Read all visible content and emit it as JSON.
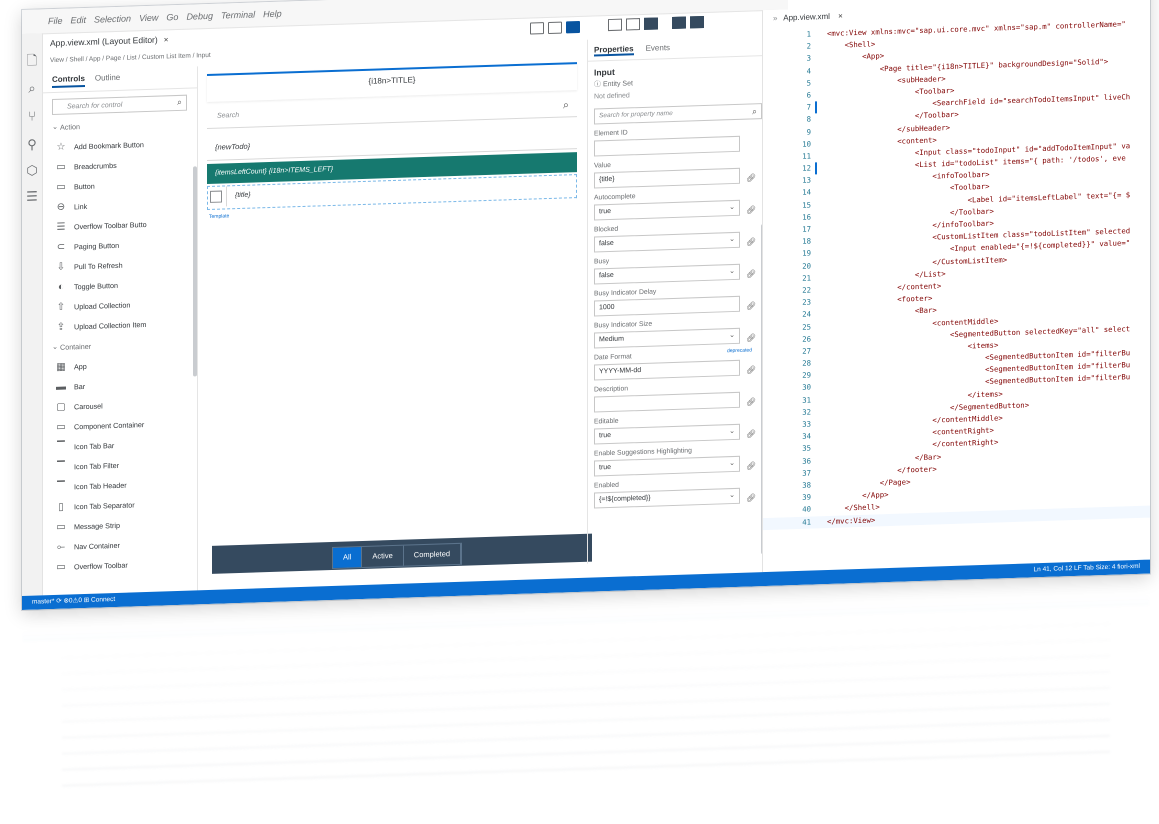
{
  "menu": [
    "File",
    "Edit",
    "Selection",
    "View",
    "Go",
    "Debug",
    "Terminal",
    "Help"
  ],
  "editor_tab": {
    "label": "App.view.xml (Layout Editor)",
    "close": "×"
  },
  "breadcrumb": "View / Shell / App / Page / List / Custom List Item / Input",
  "controls_tabs": [
    "Controls",
    "Outline"
  ],
  "controls_search_placeholder": "Search for control",
  "controls": [
    {
      "label": "Action",
      "group": true,
      "icon": "chevron-down-icon"
    },
    {
      "label": "Add Bookmark Button",
      "icon": "star-icon"
    },
    {
      "label": "Breadcrumbs",
      "icon": "breadcrumbs-icon"
    },
    {
      "label": "Button",
      "icon": "button-icon"
    },
    {
      "label": "Link",
      "icon": "link-icon"
    },
    {
      "label": "Overflow Toolbar Butto",
      "icon": "list-icon"
    },
    {
      "label": "Paging Button",
      "icon": "paging-icon"
    },
    {
      "label": "Pull To Refresh",
      "icon": "pull-down-icon"
    },
    {
      "label": "Toggle Button",
      "icon": "toggle-icon"
    },
    {
      "label": "Upload Collection",
      "icon": "upload-icon"
    },
    {
      "label": "Upload Collection Item",
      "icon": "upload-item-icon"
    },
    {
      "label": "Container",
      "group": true,
      "icon": "chevron-down-icon"
    },
    {
      "label": "App",
      "icon": "grid-icon"
    },
    {
      "label": "Bar",
      "icon": "bar-icon"
    },
    {
      "label": "Carousel",
      "icon": "carousel-icon"
    },
    {
      "label": "Component Container",
      "icon": "container-icon"
    },
    {
      "label": "Icon Tab Bar",
      "icon": "tab-bar-icon"
    },
    {
      "label": "Icon Tab Filter",
      "icon": "tab-filter-icon"
    },
    {
      "label": "Icon Tab Header",
      "icon": "tab-header-icon"
    },
    {
      "label": "Icon Tab Separator",
      "icon": "tab-separator-icon"
    },
    {
      "label": "Message Strip",
      "icon": "message-strip-icon"
    },
    {
      "label": "Nav Container",
      "icon": "nav-container-icon"
    },
    {
      "label": "Overflow Toolbar",
      "icon": "overflow-toolbar-icon"
    }
  ],
  "canvas": {
    "title": "{i18n>TITLE}",
    "search_placeholder": "Search",
    "new_todo": "{newTodo}",
    "info_toolbar": "{itemsLeftCount} {i18n>ITEMS_LEFT}",
    "item_title": "{title}",
    "template_label": "Template",
    "segments": [
      "All",
      "Active",
      "Completed"
    ]
  },
  "properties": {
    "tabs": [
      "Properties",
      "Events"
    ],
    "control": "Input",
    "entity_set_label": "Entity Set",
    "entity_set_value": "Not defined",
    "search_placeholder": "Search for property name",
    "fields": [
      {
        "label": "Element ID",
        "value": ""
      },
      {
        "label": "Value",
        "value": "{title}",
        "link": true
      },
      {
        "label": "Autocomplete",
        "value": "true",
        "dropdown": true,
        "link": true
      },
      {
        "label": "Blocked",
        "value": "false",
        "dropdown": true,
        "link": true
      },
      {
        "label": "Busy",
        "value": "false",
        "dropdown": true,
        "link": true
      },
      {
        "label": "Busy Indicator Delay",
        "value": "1000",
        "link": true
      },
      {
        "label": "Busy Indicator Size",
        "value": "Medium",
        "dropdown": true,
        "link": true
      },
      {
        "label": "Date Format",
        "value": "YYYY-MM-dd",
        "link": true,
        "tag": "deprecated"
      },
      {
        "label": "Description",
        "value": "",
        "link": true
      },
      {
        "label": "Editable",
        "value": "true",
        "dropdown": true,
        "link": true
      },
      {
        "label": "Enable Suggestions Highlighting",
        "value": "true",
        "dropdown": true,
        "link": true
      },
      {
        "label": "Enabled",
        "value": "{=!${completed}}",
        "dropdown": true,
        "link": true
      }
    ]
  },
  "code": {
    "tab": "App.view.xml",
    "close": "×",
    "lines": [
      "<mvc:View xmlns:mvc=\"sap.ui.core.mvc\" xmlns=\"sap.m\" controllerName=\"",
      "    <Shell>",
      "        <App>",
      "            <Page title=\"{i18n>TITLE}\" backgroundDesign=\"Solid\">",
      "                <subHeader>",
      "                    <Toolbar>",
      "                        <SearchField id=\"searchTodoItemsInput\" liveCh",
      "                    </Toolbar>",
      "                </subHeader>",
      "                <content>",
      "                    <Input class=\"todoInput\" id=\"addTodoItemInput\" va",
      "                    <List id=\"todoList\" items=\"{ path: '/todos', eve",
      "                        <infoToolbar>",
      "                            <Toolbar>",
      "                                <Label id=\"itemsLeftLabel\" text=\"{= $",
      "                            </Toolbar>",
      "                        </infoToolbar>",
      "                        <CustomListItem class=\"todoListItem\" selected",
      "                            <Input enabled=\"{=!${completed}}\" value=\"",
      "                        </CustomListItem>",
      "                    </List>",
      "                </content>",
      "                <footer>",
      "                    <Bar>",
      "                        <contentMiddle>",
      "                            <SegmentedButton selectedKey=\"all\" select",
      "                                <items>",
      "                                    <SegmentedButtonItem id=\"filterBu",
      "                                    <SegmentedButtonItem id=\"filterBu",
      "                                    <SegmentedButtonItem id=\"filterBu",
      "                                </items>",
      "                            </SegmentedButton>",
      "                        </contentMiddle>",
      "                        <contentRight>",
      "                        </contentRight>",
      "                    </Bar>",
      "                </footer>",
      "            </Page>",
      "        </App>",
      "    </Shell>",
      "</mvc:View>"
    ]
  },
  "status": {
    "left": "master*  ⟳  ⊗0⚠0  ⊞ Connect",
    "right": "Ln 41, Col 12   LF   Tab Size: 4   fiori-xml"
  },
  "colors": {
    "accent": "#0a6ed1",
    "info_toolbar": "#16796f",
    "footer": "#354a5f",
    "xml_tag": "#800000",
    "line_number": "#237893"
  }
}
